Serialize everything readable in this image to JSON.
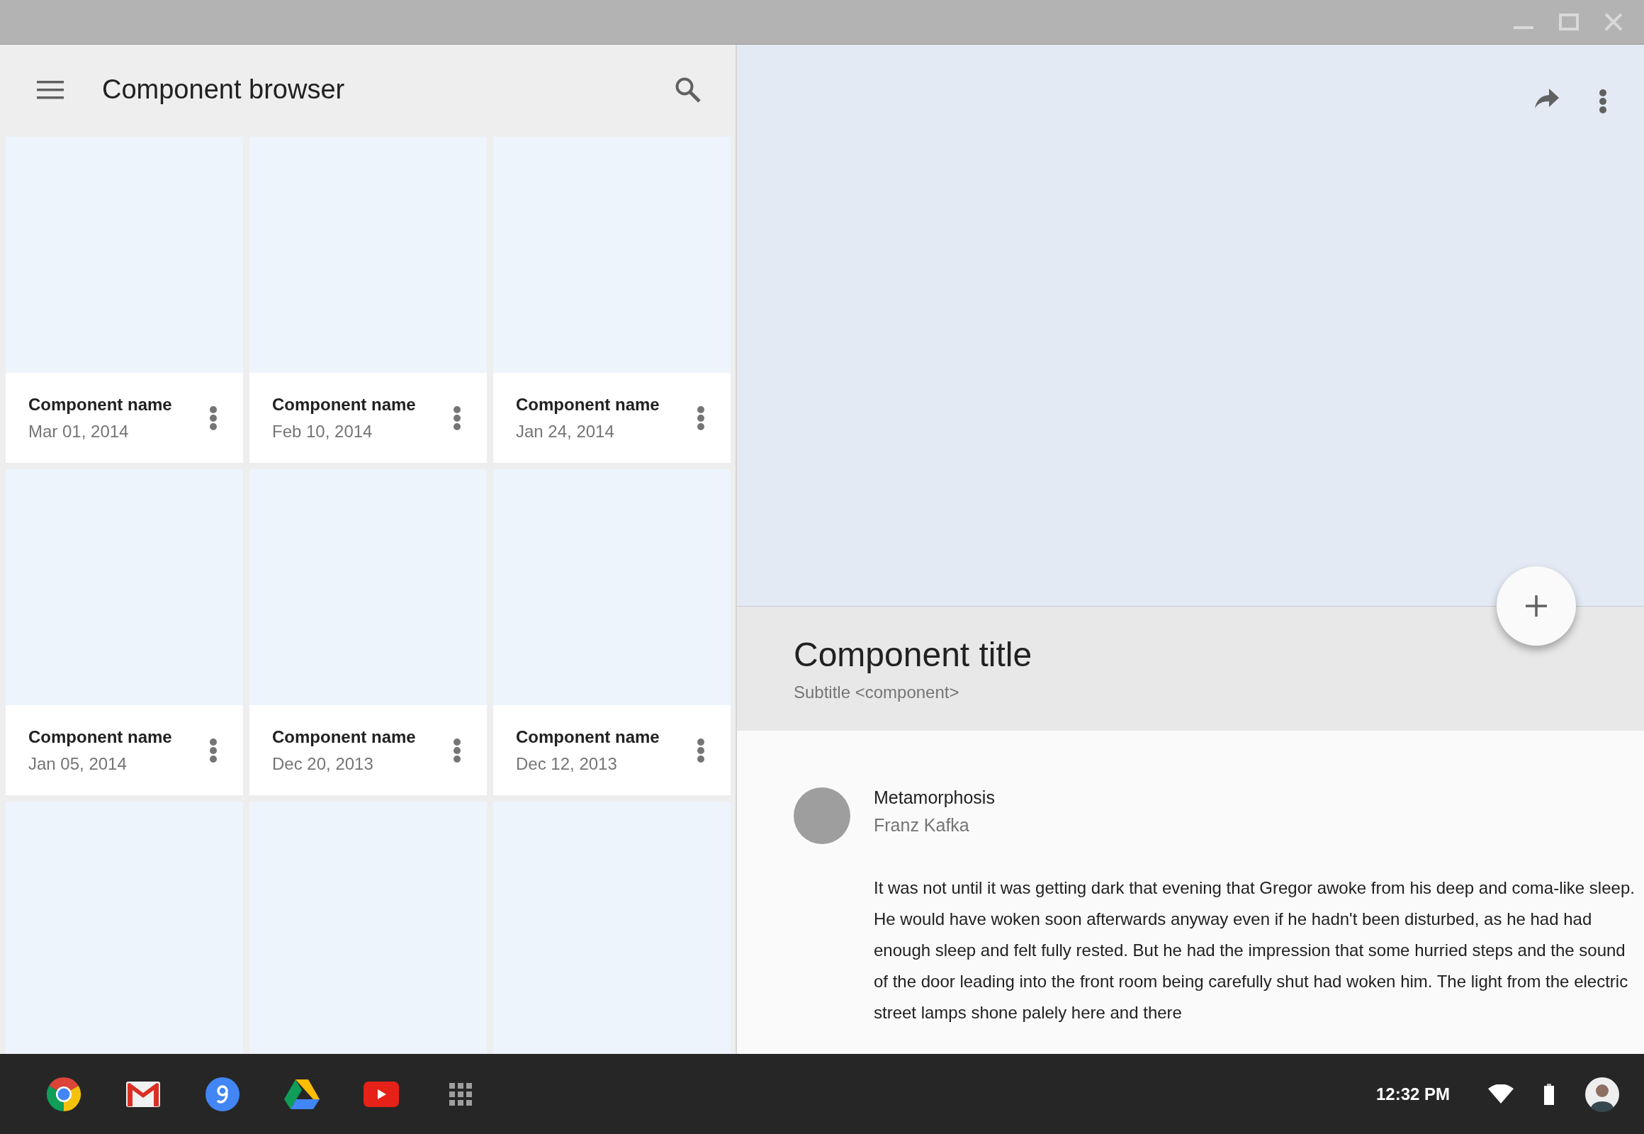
{
  "toolbar": {
    "title": "Component browser"
  },
  "cards": [
    {
      "kind": "full",
      "name": "Component name",
      "date": "Mar 01, 2014"
    },
    {
      "kind": "full",
      "name": "Component name",
      "date": "Feb 10, 2014"
    },
    {
      "kind": "full",
      "name": "Component name",
      "date": "Jan 24, 2014"
    },
    {
      "kind": "full",
      "name": "Component name",
      "date": "Jan 05, 2014"
    },
    {
      "kind": "full",
      "name": "Component name",
      "date": "Dec 20, 2013"
    },
    {
      "kind": "full",
      "name": "Component name",
      "date": "Dec 12, 2013"
    },
    {
      "kind": "image_only"
    },
    {
      "kind": "image_only"
    },
    {
      "kind": "image_only"
    }
  ],
  "detail": {
    "title": "Component title",
    "subtitle": "Subtitle <component>",
    "item": {
      "title": "Metamorphosis",
      "author": "Franz Kafka"
    },
    "body": "It was not until it was getting dark that evening that Gregor awoke from his deep and coma-like sleep. He would have woken soon afterwards anyway even if he hadn't been disturbed, as he had had enough sleep and felt fully rested. But he had the impression that some hurried steps and the sound of the door leading into the front room being carefully shut had woken him. The light from the electric street lamps shone palely here and there"
  },
  "taskbar": {
    "apps": [
      {
        "kind": "chrome"
      },
      {
        "kind": "mail"
      },
      {
        "kind": "search"
      },
      {
        "kind": "drive"
      },
      {
        "kind": "video"
      },
      {
        "kind": "launcher"
      }
    ],
    "time": "12:32 PM"
  }
}
